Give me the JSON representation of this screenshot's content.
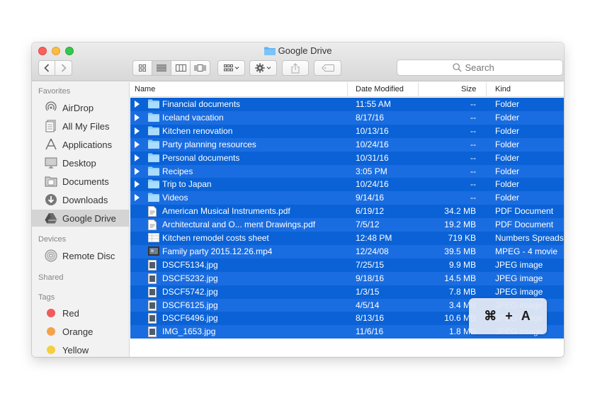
{
  "window": {
    "title": "Google Drive"
  },
  "toolbar": {
    "back_icon": "chevron-left-icon",
    "forward_icon": "chevron-right-icon",
    "view_modes": [
      "icon-view-icon",
      "list-view-icon",
      "column-view-icon",
      "coverflow-view-icon"
    ],
    "arrange_icon": "arrange-icon",
    "action_icon": "gear-icon",
    "share_icon": "share-icon",
    "tag_icon": "tag-icon",
    "search_placeholder": "Search"
  },
  "sidebar": {
    "favorites_header": "Favorites",
    "favorites": [
      {
        "label": "AirDrop",
        "icon": "airdrop-icon"
      },
      {
        "label": "All My Files",
        "icon": "all-files-icon"
      },
      {
        "label": "Applications",
        "icon": "applications-icon"
      },
      {
        "label": "Desktop",
        "icon": "desktop-icon"
      },
      {
        "label": "Documents",
        "icon": "documents-icon"
      },
      {
        "label": "Downloads",
        "icon": "downloads-icon"
      },
      {
        "label": "Google Drive",
        "icon": "google-drive-icon"
      }
    ],
    "devices_header": "Devices",
    "devices": [
      {
        "label": "Remote Disc",
        "icon": "disc-icon"
      }
    ],
    "shared_header": "Shared",
    "tags_header": "Tags",
    "tags": [
      {
        "label": "Red",
        "color": "#f05b5b"
      },
      {
        "label": "Orange",
        "color": "#f7a14a"
      },
      {
        "label": "Yellow",
        "color": "#f5cf3f"
      }
    ]
  },
  "columns": {
    "name": "Name",
    "date": "Date Modified",
    "size": "Size",
    "kind": "Kind"
  },
  "files": [
    {
      "name": "Financial documents",
      "date": "11:55 AM",
      "size": "--",
      "kind": "Folder",
      "type": "folder"
    },
    {
      "name": "Iceland vacation",
      "date": "8/17/16",
      "size": "--",
      "kind": "Folder",
      "type": "folder"
    },
    {
      "name": "Kitchen renovation",
      "date": "10/13/16",
      "size": "--",
      "kind": "Folder",
      "type": "folder"
    },
    {
      "name": "Party planning resources",
      "date": "10/24/16",
      "size": "--",
      "kind": "Folder",
      "type": "folder"
    },
    {
      "name": "Personal documents",
      "date": "10/31/16",
      "size": "--",
      "kind": "Folder",
      "type": "folder"
    },
    {
      "name": "Recipes",
      "date": "3:05 PM",
      "size": "--",
      "kind": "Folder",
      "type": "folder"
    },
    {
      "name": "Trip to Japan",
      "date": "10/24/16",
      "size": "--",
      "kind": "Folder",
      "type": "folder"
    },
    {
      "name": "Videos",
      "date": "9/14/16",
      "size": "--",
      "kind": "Folder",
      "type": "folder"
    },
    {
      "name": "American Musical Instruments.pdf",
      "date": "6/19/12",
      "size": "34.2 MB",
      "kind": "PDF Document",
      "type": "pdf"
    },
    {
      "name": "Architectural and O... ment Drawings.pdf",
      "date": "7/5/12",
      "size": "19.2 MB",
      "kind": "PDF Document",
      "type": "pdf"
    },
    {
      "name": "Kitchen remodel costs sheet",
      "date": "12:48 PM",
      "size": "719  KB",
      "kind": "Numbers Spreadsheet",
      "type": "sheet"
    },
    {
      "name": "Family party 2015.12.26.mp4",
      "date": "12/24/08",
      "size": "39.5 MB",
      "kind": "MPEG - 4 movie",
      "type": "movie"
    },
    {
      "name": "DSCF5134.jpg",
      "date": "7/25/15",
      "size": "9.9 MB",
      "kind": "JPEG image",
      "type": "image"
    },
    {
      "name": "DSCF5232.jpg",
      "date": "9/18/16",
      "size": "14.5 MB",
      "kind": "JPEG image",
      "type": "image"
    },
    {
      "name": "DSCF5742.jpg",
      "date": "1/3/15",
      "size": "7.8 MB",
      "kind": "JPEG image",
      "type": "image"
    },
    {
      "name": "DSCF6125.jpg",
      "date": "4/5/14",
      "size": "3.4 MB",
      "kind": "JPEG image",
      "type": "image"
    },
    {
      "name": "DSCF6496.jpg",
      "date": "8/13/16",
      "size": "10.6 MB",
      "kind": "JPEG image",
      "type": "image"
    },
    {
      "name": "IMG_1653.jpg",
      "date": "11/6/16",
      "size": "1.8 MB",
      "kind": "JPEG image",
      "type": "image"
    }
  ],
  "shortcut": {
    "cmd": "⌘",
    "plus": "+",
    "key": "A"
  }
}
